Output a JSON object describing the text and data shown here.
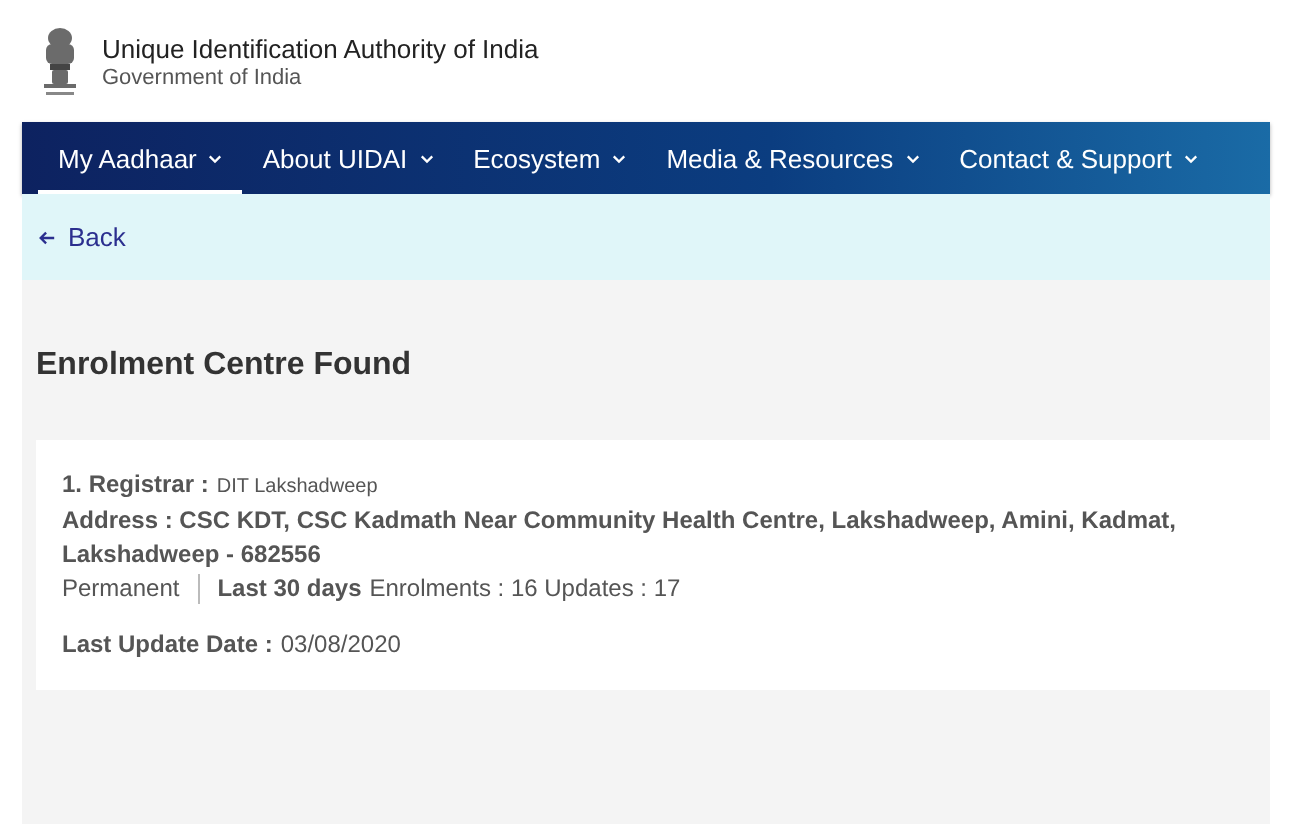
{
  "header": {
    "organization": "Unique Identification Authority of India",
    "government": "Government of India"
  },
  "nav": {
    "items": [
      {
        "label": "My Aadhaar",
        "selected": true
      },
      {
        "label": "About UIDAI",
        "selected": false
      },
      {
        "label": "Ecosystem",
        "selected": false
      },
      {
        "label": "Media & Resources",
        "selected": false
      },
      {
        "label": "Contact & Support",
        "selected": false
      }
    ]
  },
  "back_link": "Back",
  "heading": "Enrolment Centre Found",
  "results": [
    {
      "registrar_label": "1. Registrar :",
      "registrar": "DIT Lakshadweep",
      "address": "Address : CSC KDT, CSC Kadmath Near Community Health Centre, Lakshadweep, Amini, Kadmat, Lakshadweep - 682556",
      "centre_type": "Permanent",
      "period": "Last 30 days",
      "counts": "Enrolments : 16 Updates : 17",
      "date_label": "Last Update Date :",
      "date": "03/08/2020"
    }
  ]
}
